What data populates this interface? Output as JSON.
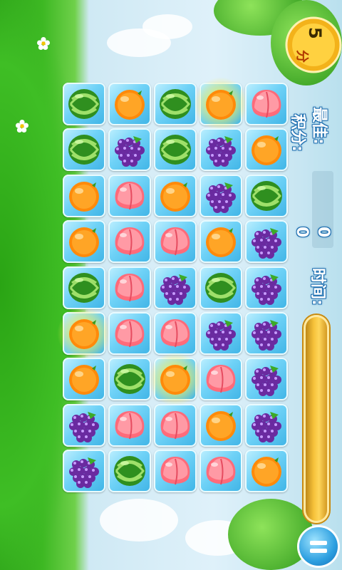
{
  "hud": {
    "best_label": "最佳:",
    "score_label": "积分:",
    "best_value": "0",
    "score_value": "0",
    "time_label": "时间:",
    "coins": "5",
    "coin_unit": "分",
    "time_remaining_fraction": 1.0
  },
  "board": {
    "rows": 9,
    "cols": 5,
    "cells": [
      [
        "watermelon",
        "orange",
        "watermelon",
        "orange",
        "peach"
      ],
      [
        "watermelon",
        "grape",
        "watermelon",
        "grape",
        "orange"
      ],
      [
        "orange",
        "peach",
        "orange",
        "grape",
        "watermelon"
      ],
      [
        "orange",
        "peach",
        "peach",
        "orange",
        "grape"
      ],
      [
        "watermelon",
        "peach",
        "grape",
        "watermelon",
        "grape"
      ],
      [
        "orange",
        "peach",
        "peach",
        "grape",
        "grape"
      ],
      [
        "orange",
        "watermelon",
        "orange",
        "peach",
        "grape"
      ],
      [
        "grape",
        "peach",
        "peach",
        "orange",
        "grape"
      ],
      [
        "grape",
        "watermelon",
        "peach",
        "peach",
        "orange"
      ]
    ],
    "highlighted": [
      [
        0,
        3
      ],
      [
        5,
        0
      ],
      [
        6,
        2
      ]
    ]
  },
  "icons": {
    "pause": "pause-icon",
    "coin": "coin-icon"
  }
}
